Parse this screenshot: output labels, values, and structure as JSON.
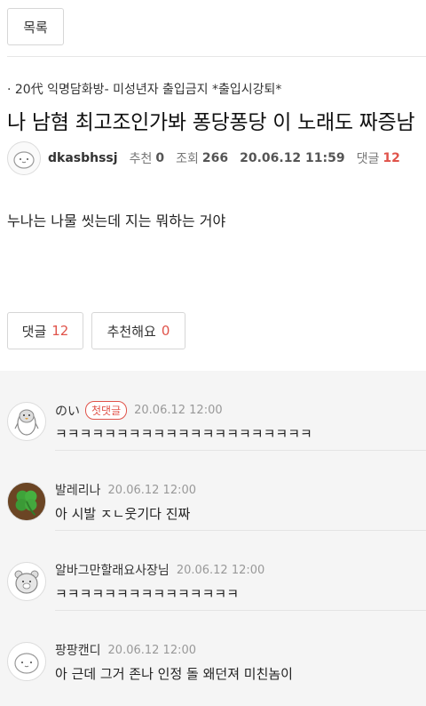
{
  "nav": {
    "list_label": "목록"
  },
  "post": {
    "board": "· 20代 익명담화방- 미성년자 출입금지 *출입시강퇴*",
    "title": "나 남혐 최고조인가봐 퐁당퐁당 이 노래도 짜증남",
    "author": "dkasbhssj",
    "recommend_label": "추천",
    "recommend_count": "0",
    "views_label": "조회",
    "views_count": "266",
    "date": "20.06.12 11:59",
    "comments_label": "댓글",
    "comments_count": "12",
    "body": "누나는 나물 씻는데 지는 뭐하는 거야"
  },
  "actions": {
    "comments_label": "댓글",
    "comments_count": "12",
    "recommend_label": "추천해요",
    "recommend_count": "0"
  },
  "comments": [
    {
      "nick": "のい",
      "badge": "첫댓글",
      "time": "20.06.12 12:00",
      "text": "ㅋㅋㅋㅋㅋㅋㅋㅋㅋㅋㅋㅋㅋㅋㅋㅋㅋㅋㅋㅋㅋ",
      "avatar": "penguin-avatar-icon"
    },
    {
      "nick": "발레리나",
      "time": "20.06.12 12:00",
      "text": "아 시발 ㅈㄴ웃기다 진짜",
      "avatar": "clover-avatar-icon"
    },
    {
      "nick": "알바그만할래요사장님",
      "time": "20.06.12 12:00",
      "text": "ㅋㅋㅋㅋㅋㅋㅋㅋㅋㅋㅋㅋㅋㅋㅋ",
      "avatar": "bear-avatar-icon"
    },
    {
      "nick": "팡팡캔디",
      "time": "20.06.12 12:00",
      "text": "아 근데 그거 존나 인정 돌 왜던져 미친놈이",
      "avatar": "blob-avatar-icon"
    }
  ]
}
